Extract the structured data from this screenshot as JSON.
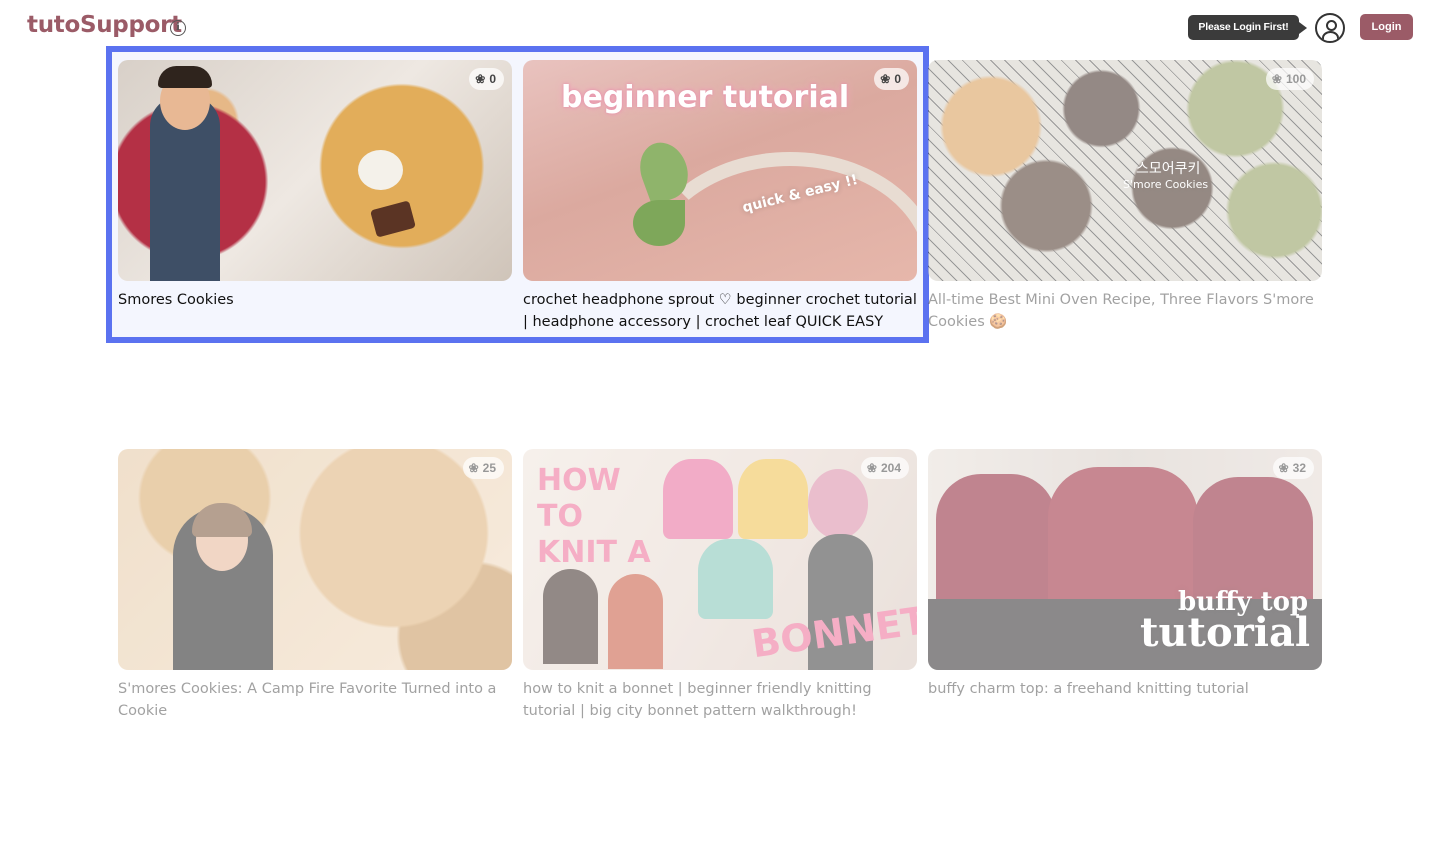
{
  "header": {
    "logo": "tutoSupport",
    "info_icon": "info-icon",
    "tooltip": "Please Login First!",
    "avatar_icon": "user-avatar-icon",
    "login_label": "Login"
  },
  "colors": {
    "brand": "#9b5b67",
    "highlight": "#5b72f0"
  },
  "videos": [
    {
      "title": "Smores Cookies",
      "likes": "0",
      "like_icon": "paw-icon"
    },
    {
      "title": "crochet headphone sprout ♡ beginner crochet tutorial | headphone accessory | crochet leaf QUICK EASY",
      "likes": "0",
      "like_icon": "paw-icon",
      "thumb_text_main": "beginner tutorial",
      "thumb_text_sub": "quick & easy !!"
    },
    {
      "title": "All-time Best Mini Oven Recipe, Three Flavors S'more Cookies 🍪",
      "likes": "100",
      "like_icon": "paw-icon",
      "thumb_text_main": "스모어쿠키",
      "thumb_text_sub": "S'more Cookies"
    },
    {
      "title": "S'mores Cookies: A Camp Fire Favorite Turned into a Cookie",
      "likes": "25",
      "like_icon": "paw-icon"
    },
    {
      "title": "how to knit a bonnet | beginner friendly knitting tutorial | big city bonnet pattern walkthrough!",
      "likes": "204",
      "like_icon": "paw-icon",
      "thumb_text_main": "HOW TO KNIT A",
      "thumb_text_sub": "BONNET!"
    },
    {
      "title": "buffy charm top: a freehand knitting tutorial",
      "likes": "32",
      "like_icon": "paw-icon",
      "thumb_text_main": "buffy top",
      "thumb_text_sub": "tutorial"
    }
  ]
}
